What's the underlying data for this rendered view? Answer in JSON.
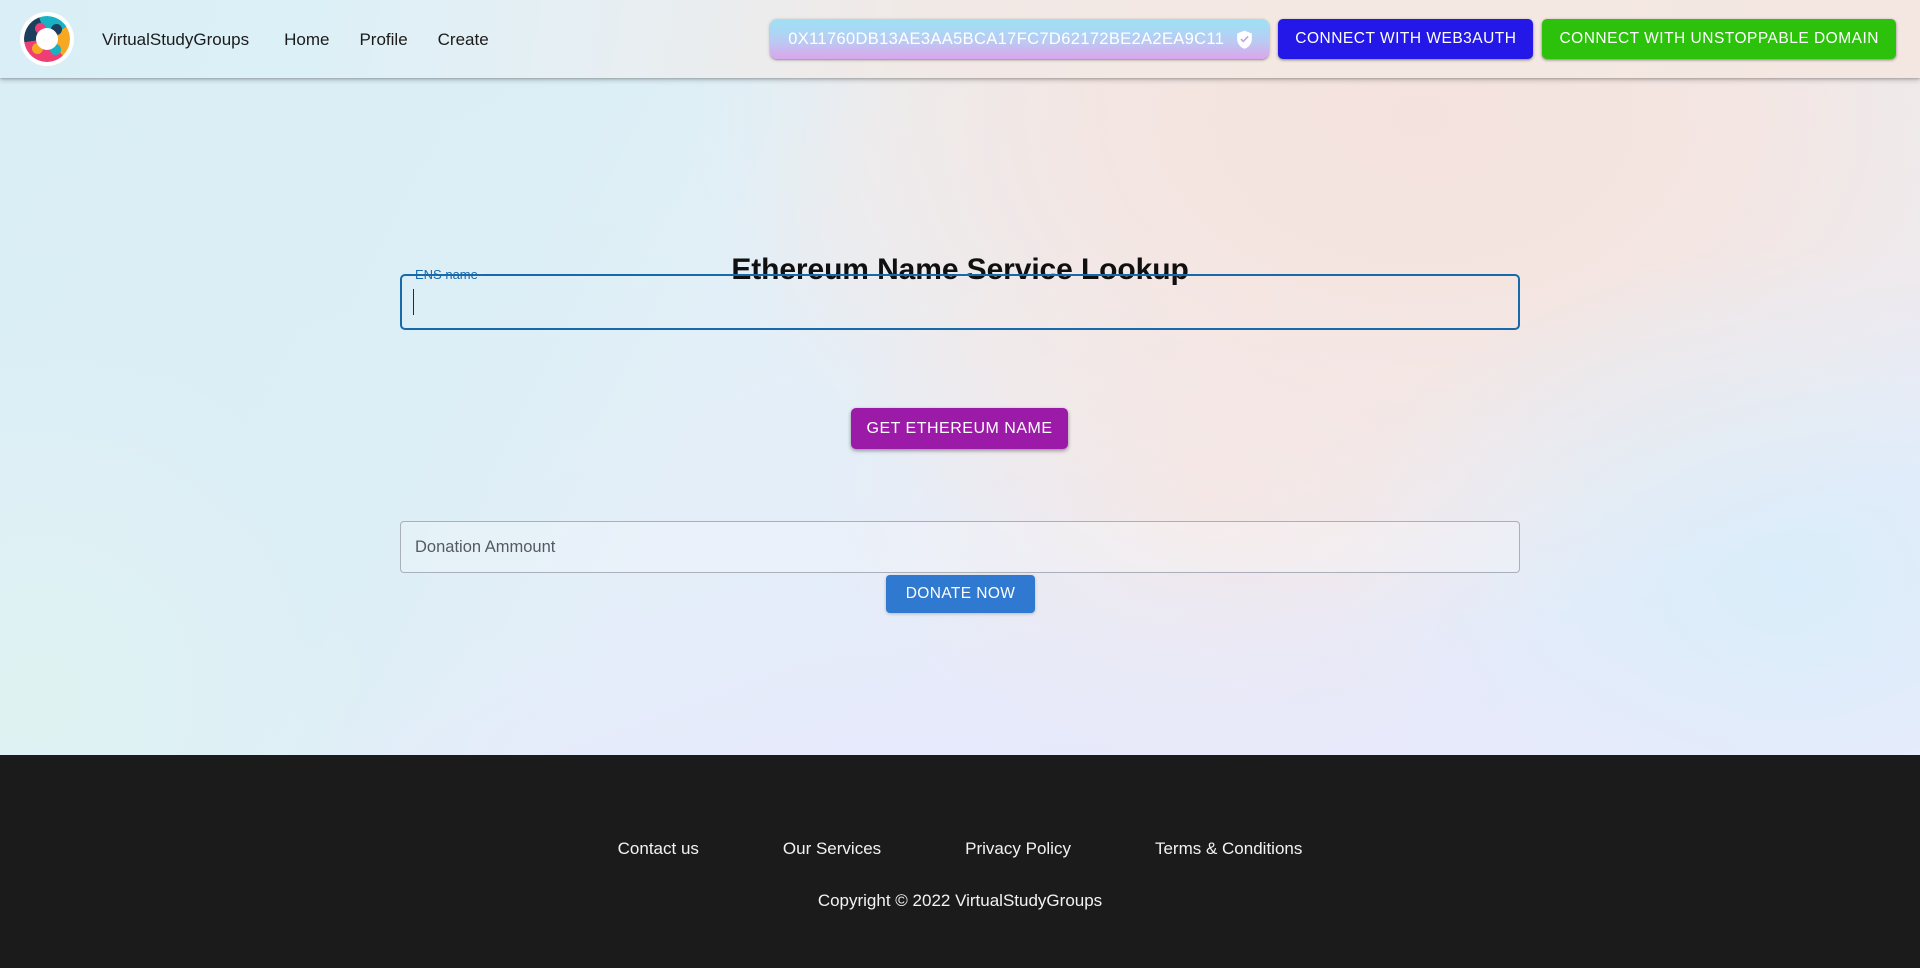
{
  "navbar": {
    "logo_icon": "virtualstudygroups-logo",
    "brand": "VirtualStudyGroups",
    "links": [
      {
        "label": "Home"
      },
      {
        "label": "Profile"
      },
      {
        "label": "Create"
      }
    ],
    "wallet": {
      "address": "0X11760DB13AE3AA5BCA17FC7D62172BE2A2EA9C11",
      "badge_icon": "verified-shield-icon",
      "gradient_from": "#9fe0f3",
      "gradient_to": "#d9a7ec"
    },
    "connect_web3auth": {
      "label": "CONNECT WITH WEB3AUTH",
      "color": "#2318e8"
    },
    "connect_unstoppable": {
      "label": "CONNECT WITH UNSTOPPABLE DOMAIN",
      "color": "#2cc20c"
    }
  },
  "main": {
    "title": "Ethereum Name Service Lookup",
    "ens_field": {
      "label": "ENS name",
      "value": "",
      "placeholder": "",
      "focused": true,
      "accent_color": "#1769aa"
    },
    "get_name_button": {
      "label": "GET ETHEREUM NAME",
      "color": "#9c1aa8"
    },
    "donation_field": {
      "value": "",
      "placeholder": "Donation Ammount"
    },
    "donate_button": {
      "label": "DONATE NOW",
      "color": "#3079d0"
    }
  },
  "footer": {
    "links": [
      {
        "label": "Contact us"
      },
      {
        "label": "Our Services"
      },
      {
        "label": "Privacy Policy"
      },
      {
        "label": "Terms & Conditions"
      }
    ],
    "copyright": "Copyright © 2022 VirtualStudyGroups",
    "background": "#1c1b1b"
  }
}
